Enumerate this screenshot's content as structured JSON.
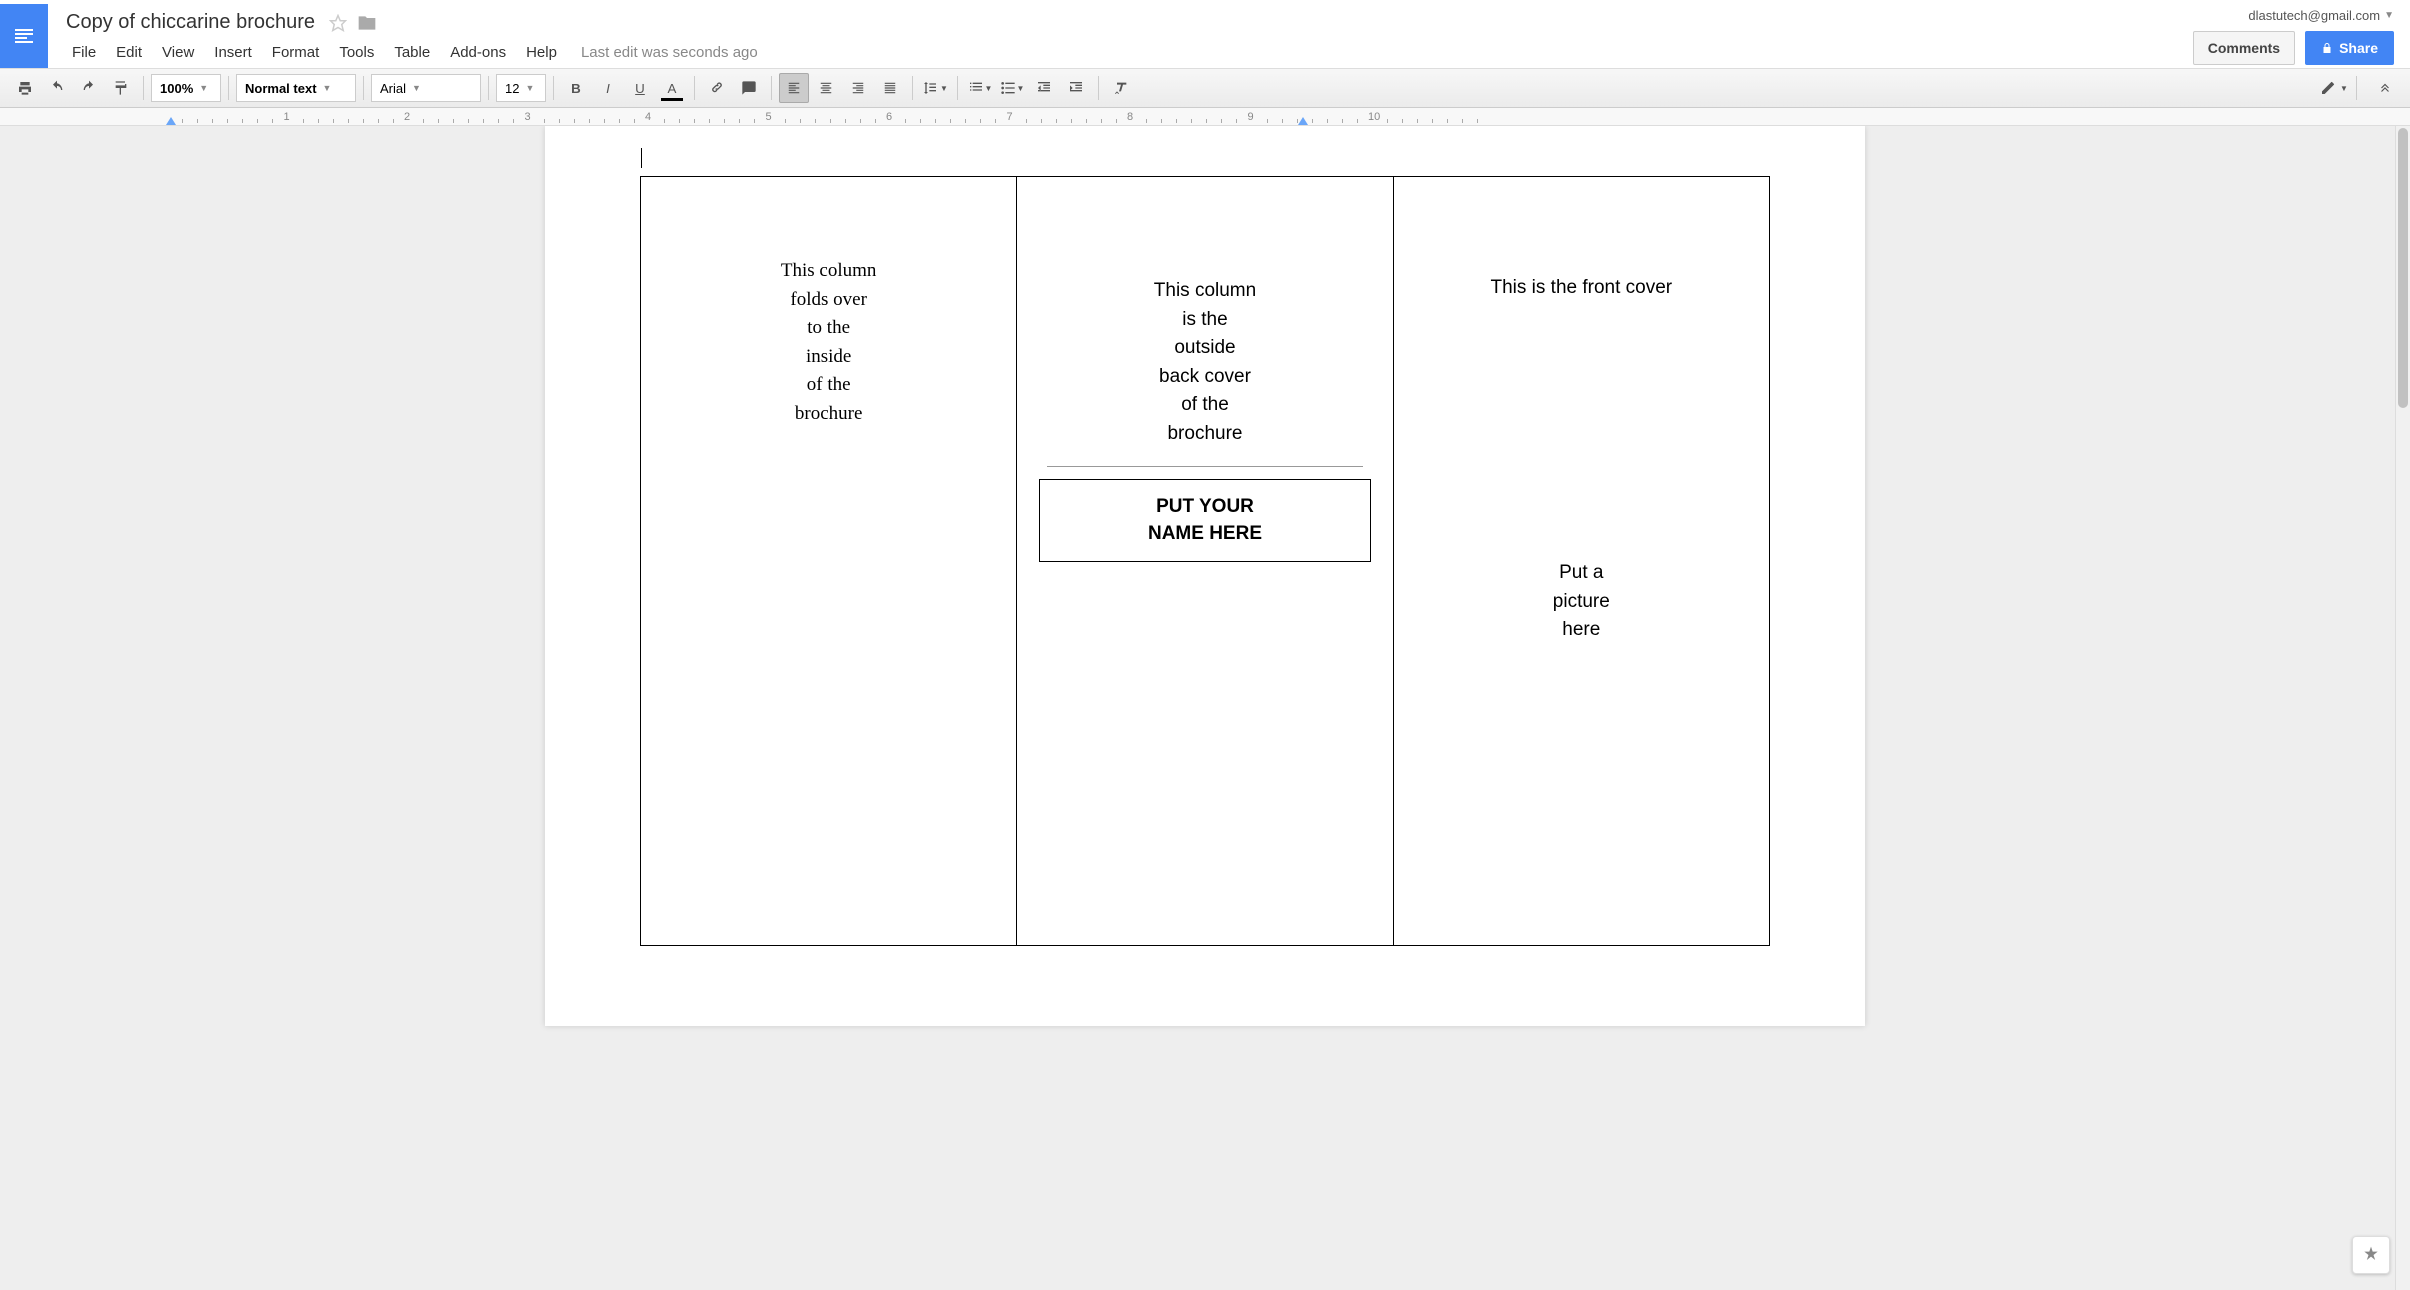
{
  "header": {
    "title": "Copy of chiccarine brochure",
    "user_email": "dlastutech@gmail.com",
    "comments_label": "Comments",
    "share_label": "Share",
    "last_edit": "Last edit was seconds ago"
  },
  "menu": {
    "file": "File",
    "edit": "Edit",
    "view": "View",
    "insert": "Insert",
    "format": "Format",
    "tools": "Tools",
    "table": "Table",
    "addons": "Add-ons",
    "help": "Help"
  },
  "toolbar": {
    "zoom": "100%",
    "style": "Normal text",
    "font": "Arial",
    "fontsize": "12"
  },
  "ruler": {
    "numbers": [
      "1",
      "2",
      "3",
      "4",
      "5",
      "6",
      "7",
      "8",
      "9",
      "10"
    ]
  },
  "document": {
    "col1": "This column\nfolds over\nto the\ninside\nof the\nbrochure",
    "col2_text": "This column\nis the\noutside\nback cover\nof the\nbrochure",
    "col2_namebox": "PUT YOUR\nNAME HERE",
    "col3_title": "This is the front cover",
    "col3_pic": "Put a\npicture\nhere"
  }
}
